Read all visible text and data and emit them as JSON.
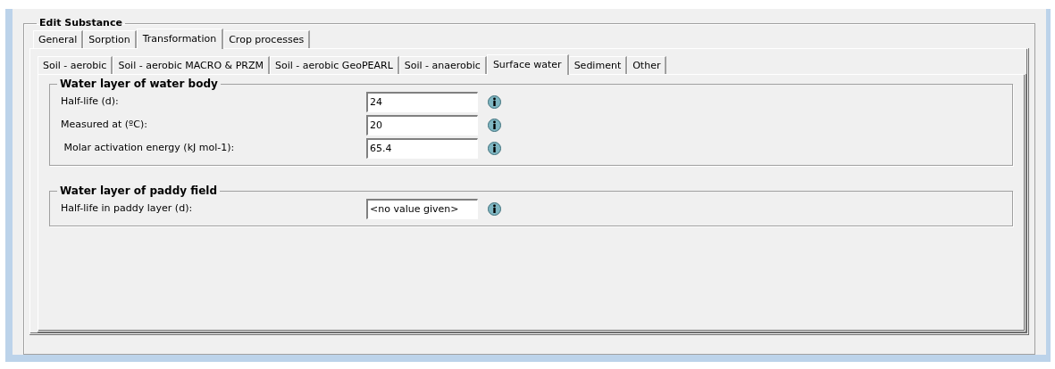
{
  "panel": {
    "title": "Edit Substance"
  },
  "main_tabs": [
    {
      "label": "General",
      "selected": false
    },
    {
      "label": "Sorption",
      "selected": false
    },
    {
      "label": "Transformation",
      "selected": true
    },
    {
      "label": "Crop processes",
      "selected": false
    }
  ],
  "sub_tabs": [
    {
      "label": "Soil - aerobic",
      "selected": false
    },
    {
      "label": "Soil - aerobic MACRO & PRZM",
      "selected": false
    },
    {
      "label": "Soil - aerobic GeoPEARL",
      "selected": false
    },
    {
      "label": "Soil - anaerobic",
      "selected": false
    },
    {
      "label": "Surface water",
      "selected": true
    },
    {
      "label": "Sediment",
      "selected": false
    },
    {
      "label": "Other",
      "selected": false
    }
  ],
  "groups": [
    {
      "title": "Water layer of water body",
      "fields": [
        {
          "label": "Half-life (d):",
          "value": "24"
        },
        {
          "label": "Measured at (ºC):",
          "value": "20"
        },
        {
          "label": " Molar activation energy (kJ mol-1):",
          "value": "65.4"
        }
      ]
    },
    {
      "title": "Water layer of paddy field",
      "fields": [
        {
          "label": "Half-life in paddy layer (d):",
          "value": "<no value given>"
        }
      ]
    }
  ]
}
